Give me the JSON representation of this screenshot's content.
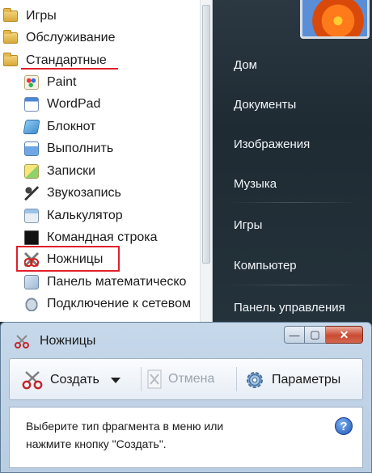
{
  "start_menu": {
    "left": {
      "folders": [
        {
          "label": "Игры",
          "icon": "folder-icon"
        },
        {
          "label": "Обслуживание",
          "icon": "folder-icon"
        },
        {
          "label": "Стандартные",
          "icon": "folder-icon"
        }
      ],
      "apps": [
        {
          "label": "Paint",
          "icon": "paint-icon"
        },
        {
          "label": "WordPad",
          "icon": "wordpad-icon"
        },
        {
          "label": "Блокнот",
          "icon": "notepad-icon"
        },
        {
          "label": "Выполнить",
          "icon": "run-icon"
        },
        {
          "label": "Записки",
          "icon": "sticky-notes-icon"
        },
        {
          "label": "Звукозапись",
          "icon": "microphone-icon"
        },
        {
          "label": "Калькулятор",
          "icon": "calculator-icon"
        },
        {
          "label": "Командная строка",
          "icon": "command-prompt-icon"
        },
        {
          "label": "Ножницы",
          "icon": "scissors-icon"
        },
        {
          "label": "Панель математическо",
          "icon": "math-panel-icon"
        },
        {
          "label": "Подключение к сетевом",
          "icon": "network-drive-icon"
        }
      ]
    },
    "right": {
      "items": [
        "Дом",
        "Документы",
        "Изображения",
        "Музыка",
        "Игры",
        "Компьютер",
        "Панель управления"
      ]
    }
  },
  "snipping_tool": {
    "title": "Ножницы",
    "toolbar": {
      "new_label": "Создать",
      "cancel_label": "Отмена",
      "options_label": "Параметры"
    },
    "hint_line1": "Выберите тип фрагмента в меню или",
    "hint_line2": "нажмите кнопку \"Создать\"."
  },
  "colors": {
    "highlight": "#e0202b",
    "right_pane_bg": "#24323b",
    "window_frame": "#c6d8ea"
  }
}
